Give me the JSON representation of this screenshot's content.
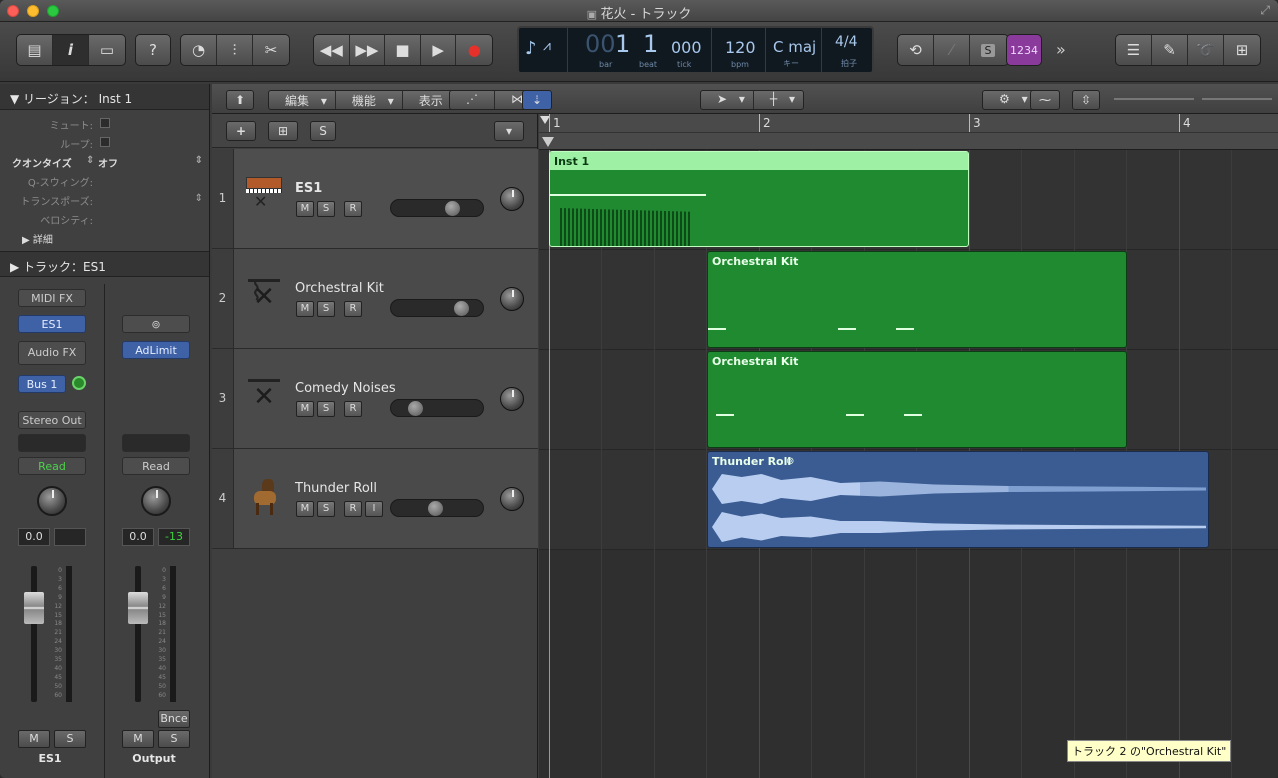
{
  "window": {
    "title": "花火 - トラック",
    "title_icon": "document-icon"
  },
  "lcd": {
    "bar": "1",
    "bar_label": "bar",
    "beat": "1",
    "beat_label": "beat",
    "tick": "000",
    "tick_label": "tick",
    "bpm": "120",
    "bpm_label": "bpm",
    "key": "C maj",
    "key_label": "キー",
    "signature": "4/4",
    "signature_label": "拍子",
    "bar_dim": "00"
  },
  "toolbar": {
    "solo_label": "S",
    "count_in": "1234",
    "more": "»"
  },
  "inspector": {
    "region_header": "リージョン： Inst 1",
    "params": [
      {
        "key": "ミュート:",
        "value": ""
      },
      {
        "key": "ループ:",
        "value": ""
      },
      {
        "key": "クオンタイズ",
        "value": "オフ"
      },
      {
        "key": "Q-スウィング:",
        "value": ""
      },
      {
        "key": "トランスポーズ:",
        "value": ""
      },
      {
        "key": "ベロシティ:",
        "value": ""
      }
    ],
    "details": "詳細",
    "track_header": "トラック：ES1"
  },
  "strips": [
    {
      "name": "ES1",
      "midi_fx": "MIDI FX",
      "instrument": "ES1",
      "audio_fx": "Audio FX",
      "send": "Bus 1",
      "output": "Stereo Out",
      "automation": "Read",
      "volume": "0.0",
      "peak": "",
      "mute": "M",
      "solo": "S"
    },
    {
      "name": "Output",
      "midi_fx": "",
      "instrument": "",
      "audio_fx": "AdLimit",
      "send": "",
      "output": "",
      "automation": "Read",
      "volume": "0.0",
      "peak": "-13",
      "mute": "M",
      "solo": "S",
      "bounce": "Bnce"
    }
  ],
  "meter_scale": [
    "0",
    "3",
    "6",
    "9",
    "12",
    "15",
    "18",
    "21",
    "24",
    "30",
    "35",
    "40",
    "45",
    "50",
    "60"
  ],
  "tracks_bar": {
    "edit": "編集",
    "functions": "機能",
    "view": "表示"
  },
  "track_list_bar": {
    "add": "+",
    "solo": "S"
  },
  "tracks": [
    {
      "num": "1",
      "name": "ES1",
      "m": "M",
      "s": "S",
      "r": "R",
      "i": "",
      "vol": 0.7,
      "icon": "synth-keyboard-icon"
    },
    {
      "num": "2",
      "name": "Orchestral Kit",
      "m": "M",
      "s": "S",
      "r": "R",
      "i": "",
      "vol": 0.82,
      "icon": "keyboard-stand-icon"
    },
    {
      "num": "3",
      "name": "Comedy Noises",
      "m": "M",
      "s": "S",
      "r": "R",
      "i": "",
      "vol": 0.2,
      "icon": "keyboard-stand-icon"
    },
    {
      "num": "4",
      "name": "Thunder Roll",
      "m": "M",
      "s": "S",
      "r": "R",
      "i": "I",
      "vol": 0.47,
      "icon": "dog-icon"
    }
  ],
  "ruler": [
    "1",
    "2",
    "3",
    "4"
  ],
  "regions": [
    {
      "name": "Inst 1",
      "track": 1
    },
    {
      "name": "Orchestral Kit",
      "track": 2
    },
    {
      "name": "Orchestral Kit",
      "track": 3
    },
    {
      "name": "Thunder Roll",
      "track": 4
    }
  ],
  "tooltip": "トラック 2 の\"Orchestral Kit\"",
  "colors": {
    "midi_region": "#1e8a2e",
    "midi_region_selected": "#2aa33a",
    "audio_region": "#3a5c92",
    "accent_blue": "#3f62a7"
  }
}
